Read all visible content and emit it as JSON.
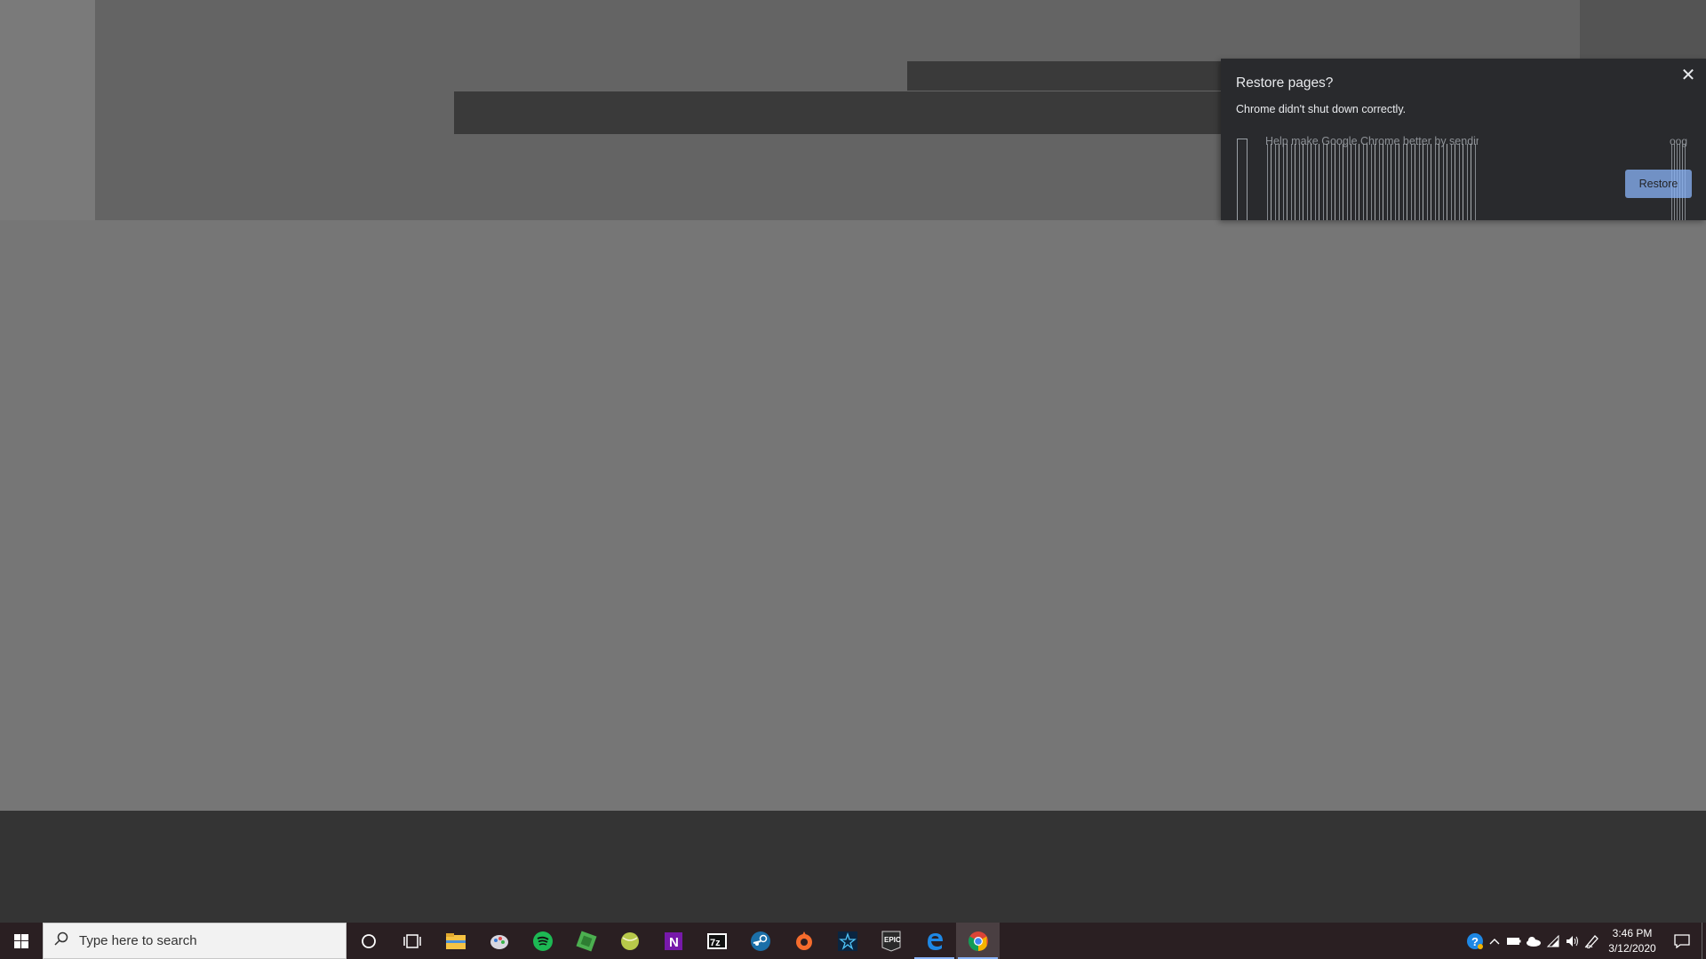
{
  "dialog": {
    "title": "Restore pages?",
    "message": "Chrome didn't shut down correctly.",
    "checkbox_label": "Help make Google Chrome better by sending",
    "checkbox_label_tail": "oogle",
    "restore_label": "Restore",
    "close_glyph": "✕"
  },
  "taskbar": {
    "search_placeholder": "Type here to search",
    "apps": [
      {
        "name": "cortana-icon"
      },
      {
        "name": "task-view-icon"
      },
      {
        "name": "file-explorer-icon"
      },
      {
        "name": "paint-3d-icon"
      },
      {
        "name": "spotify-icon"
      },
      {
        "name": "minecraft-icon"
      },
      {
        "name": "tennis-ball-app-icon"
      },
      {
        "name": "onenote-icon"
      },
      {
        "name": "7zip-icon"
      },
      {
        "name": "steam-icon"
      },
      {
        "name": "origin-icon"
      },
      {
        "name": "star-app-icon"
      },
      {
        "name": "epic-games-icon"
      },
      {
        "name": "edge-icon"
      },
      {
        "name": "chrome-icon"
      }
    ],
    "epic_label": "EPIC",
    "zip_label": "7z",
    "onenote_label": "N",
    "time": "3:46 PM",
    "date": "3/12/2020"
  },
  "colors": {
    "accent": "#8ab4f8",
    "dialog_bg": "#292a2d",
    "taskbar_bg": "#2a1f22"
  }
}
